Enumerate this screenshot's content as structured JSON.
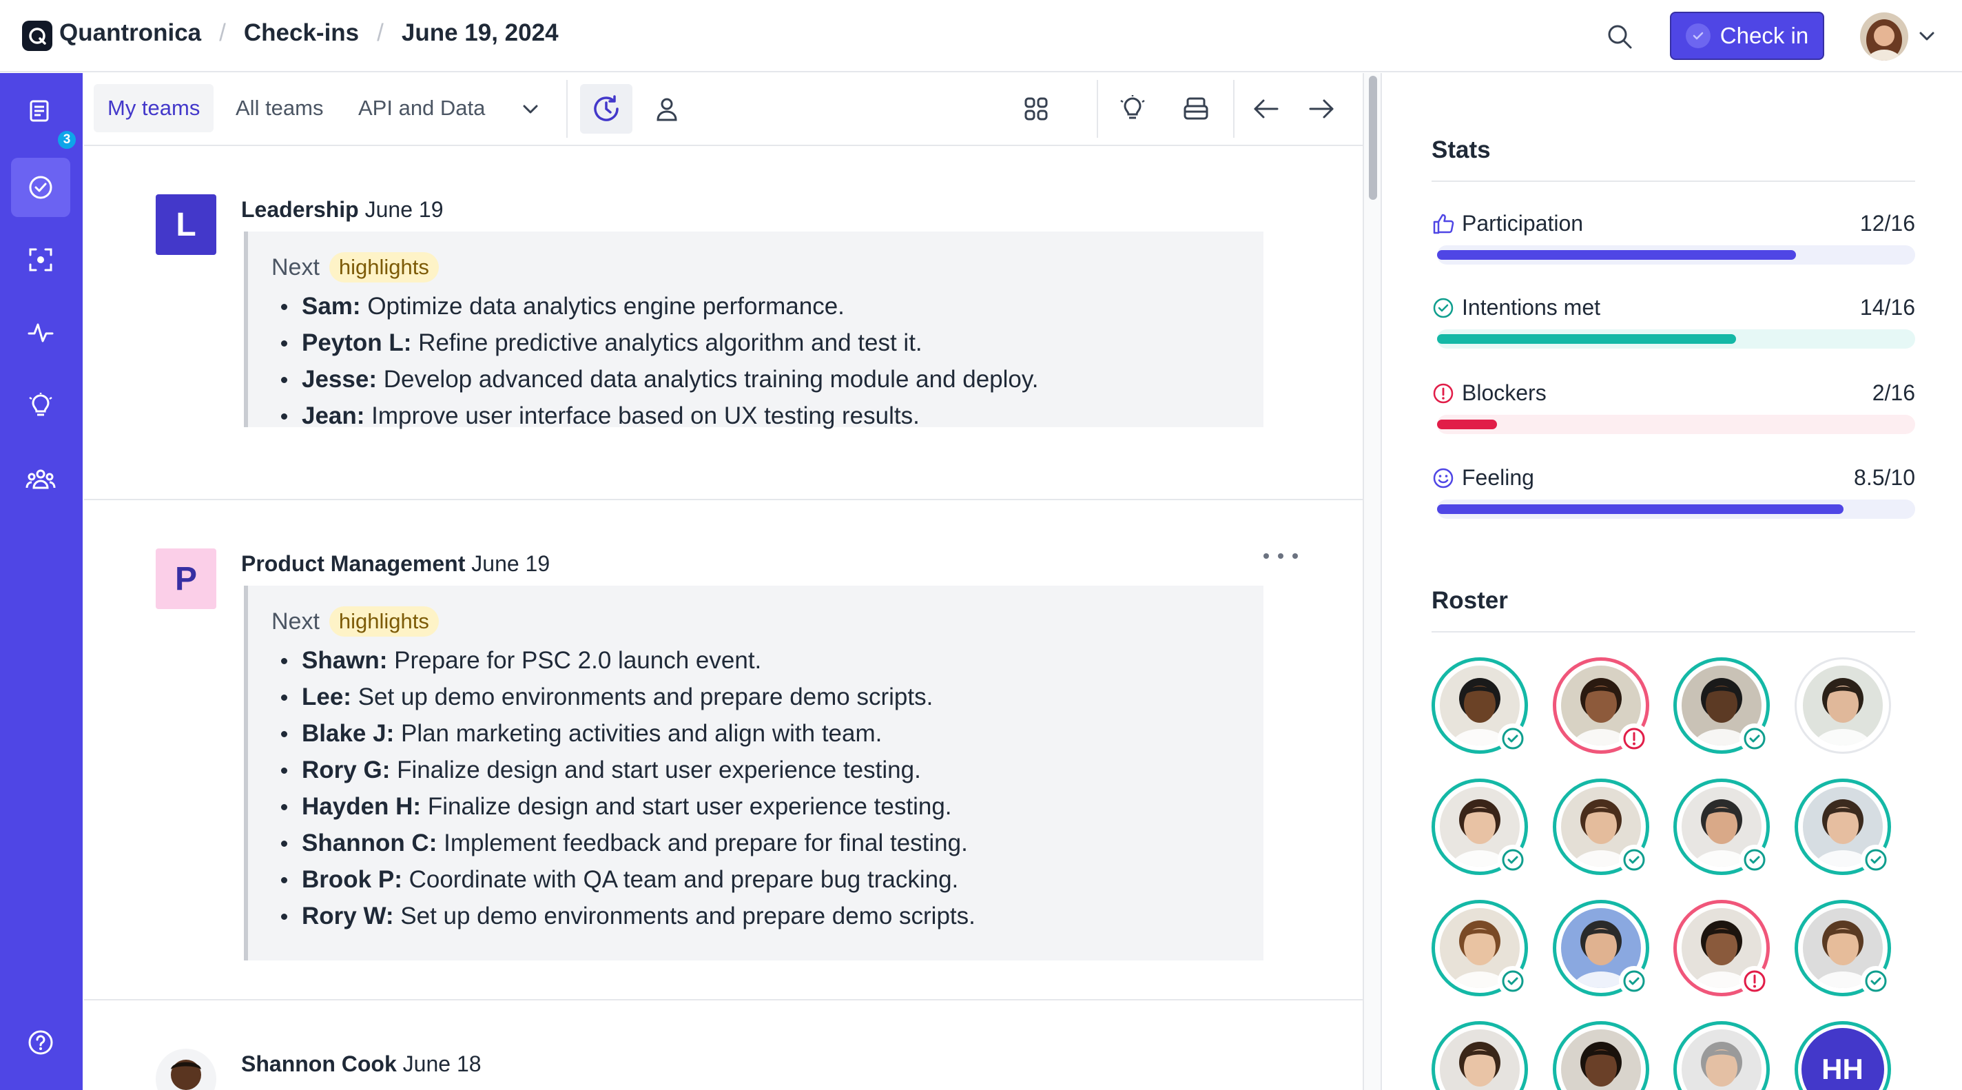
{
  "header": {
    "app_name": "Quantronica",
    "section": "Check-ins",
    "date": "June 19, 2024",
    "checkin_label": "Check in"
  },
  "rail": {
    "badge_count": "3"
  },
  "toolbar": {
    "tabs": [
      {
        "label": "My teams"
      },
      {
        "label": "All teams"
      },
      {
        "label": "API and Data"
      }
    ]
  },
  "feed": {
    "cards": [
      {
        "initial": "L",
        "team": "Leadership",
        "date": "June 19",
        "next_label": "Next",
        "highlight_label": "highlights",
        "items": [
          {
            "name": "Sam:",
            "text": " Optimize data analytics engine performance."
          },
          {
            "name": "Peyton L:",
            "text": " Refine predictive analytics algorithm and test it."
          },
          {
            "name": "Jesse:",
            "text": " Develop advanced data analytics training module and deploy."
          },
          {
            "name": "Jean:",
            "text": " Improve user interface based on UX testing results."
          }
        ]
      },
      {
        "initial": "P",
        "team": "Product Management",
        "date": "June 19",
        "next_label": "Next",
        "highlight_label": "highlights",
        "items": [
          {
            "name": "Shawn:",
            "text": " Prepare for PSC 2.0 launch event."
          },
          {
            "name": "Lee:",
            "text": " Set up demo environments and prepare demo scripts."
          },
          {
            "name": "Blake J:",
            "text": " Plan marketing activities and align with team."
          },
          {
            "name": "Rory G:",
            "text": " Finalize design and start user experience testing."
          },
          {
            "name": "Hayden H:",
            "text": " Finalize design and start user experience testing."
          },
          {
            "name": "Shannon C:",
            "text": " Implement feedback and prepare for final testing."
          },
          {
            "name": "Brook P:",
            "text": " Coordinate with QA team and prepare bug tracking."
          },
          {
            "name": "Rory W:",
            "text": " Set up demo environments and prepare demo scripts."
          }
        ]
      },
      {
        "person": "Shannon Cook",
        "date": "June 18"
      }
    ]
  },
  "stats": {
    "title": "Stats",
    "items": [
      {
        "label": "Participation",
        "value": "12/16",
        "fraction": 0.75,
        "icon": "thumbs-up-icon",
        "color": "#4f46e5",
        "track": "#eef0fb"
      },
      {
        "label": "Intentions met",
        "value": "14/16",
        "fraction": 0.625,
        "icon": "check-circle-icon",
        "color": "#14b8a6",
        "track": "#e6f8f6"
      },
      {
        "label": "Blockers",
        "value": "2/16",
        "fraction": 0.125,
        "icon": "alert-circle-icon",
        "color": "#e11d48",
        "track": "#fdeef1"
      },
      {
        "label": "Feeling",
        "value": "8.5/10",
        "fraction": 0.85,
        "icon": "smiley-icon",
        "color": "#4f46e5",
        "track": "#eef0fb"
      }
    ]
  },
  "roster": {
    "title": "Roster",
    "members": [
      {
        "status": "ok",
        "skin": "#6b4226",
        "hair": "#1a1a1a",
        "bg": "#e8e4dc"
      },
      {
        "status": "blocked",
        "skin": "#8d5a3b",
        "hair": "#2a1a10",
        "bg": "#d8d2c4"
      },
      {
        "status": "ok",
        "skin": "#5c3a24",
        "hair": "#1a1a1a",
        "bg": "#c9c2b6"
      },
      {
        "status": "none",
        "skin": "#e0b89a",
        "hair": "#2b2118",
        "bg": "#dfe3dd"
      },
      {
        "status": "ok",
        "skin": "#e8c2a4",
        "hair": "#3a2418",
        "bg": "#e9e6e1"
      },
      {
        "status": "ok",
        "skin": "#e4bc9c",
        "hair": "#4a2e1c",
        "bg": "#e4dfd6"
      },
      {
        "status": "ok",
        "skin": "#d9a988",
        "hair": "#2b2b2b",
        "bg": "#e8e6e3"
      },
      {
        "status": "ok",
        "skin": "#e6bea0",
        "hair": "#3b2a1e",
        "bg": "#d6dde2"
      },
      {
        "status": "ok",
        "skin": "#e9c3a2",
        "hair": "#7a4a26",
        "bg": "#e8e2d8"
      },
      {
        "status": "ok",
        "skin": "#e0b290",
        "hair": "#2a2a2a",
        "bg": "#8aa8e0"
      },
      {
        "status": "blocked",
        "skin": "#8a5a3c",
        "hair": "#1c140e",
        "bg": "#e6e2dc"
      },
      {
        "status": "ok",
        "skin": "#e6bc9a",
        "hair": "#5a3a22",
        "bg": "#dcdcdc"
      },
      {
        "status": "none",
        "skin": "#e9c4a6",
        "hair": "#3a2618",
        "bg": "#e6e3df"
      },
      {
        "status": "none",
        "skin": "#6a4028",
        "hair": "#1a120c",
        "bg": "#d9d4cc"
      },
      {
        "status": "none",
        "skin": "#e4c0a4",
        "hair": "#9a9a9a",
        "bg": "#e6e6e6"
      },
      {
        "status": "initials",
        "initials": "HH"
      }
    ]
  }
}
